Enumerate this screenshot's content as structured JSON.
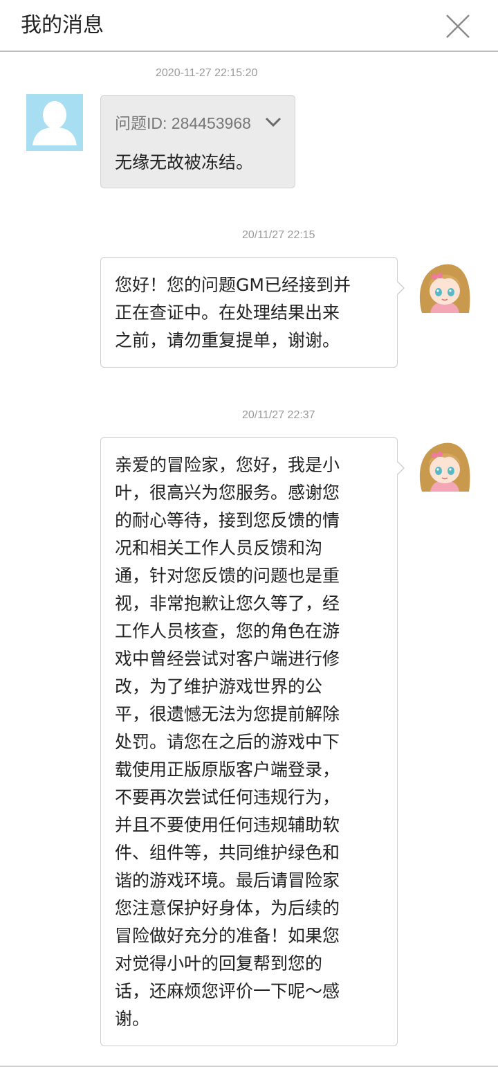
{
  "header": {
    "title": "我的消息",
    "close_icon": "close-icon"
  },
  "messages": [
    {
      "sender": "user",
      "timestamp": "2020-11-27 22:15:20",
      "question_id_label": "问题ID: 284453968",
      "expand_icon": "chevron-down-icon",
      "text": "无缘无故被冻结。"
    },
    {
      "sender": "gm",
      "timestamp": "20/11/27 22:15",
      "text": "您好！您的问题GM已经接到并\n正在查证中。在处理结果出来\n之前，请勿重复提单，谢谢。"
    },
    {
      "sender": "gm",
      "timestamp": "20/11/27 22:37",
      "text": "亲爱的冒险家，您好，我是小\n叶，很高兴为您服务。感谢您\n的耐心等待，接到您反馈的情\n况和相关工作人员反馈和沟\n通，针对您反馈的问题也是重\n视，非常抱歉让您久等了，经\n工作人员核查，您的角色在游\n戏中曾经尝试对客户端进行修\n改，为了维护游戏世界的公\n平，很遗憾无法为您提前解除\n处罚。请您在之后的游戏中下\n载使用正版原版客户端登录，\n不要再次尝试任何违规行为，\n并且不要使用任何违规辅助软\n件、组件等，共同维护绿色和\n谐的游戏环境。最后请冒险家\n您注意保护好身体，为后续的\n冒险做好充分的准备！如果您\n对觉得小叶的回复帮到您的\n话，还麻烦您评价一下呢～感\n谢。"
    }
  ],
  "colors": {
    "user_avatar_bg": "#a8def2",
    "user_bubble_bg": "#ebebeb",
    "timestamp": "#9a9a9a"
  }
}
